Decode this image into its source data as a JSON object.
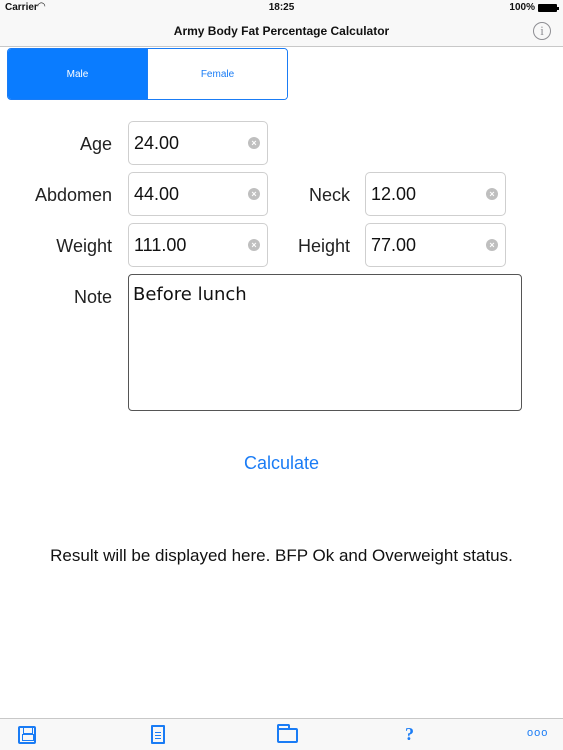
{
  "status_bar": {
    "carrier": "Carrier",
    "time": "18:25",
    "battery": "100%",
    "wifi_icon": "wifi-icon",
    "battery_icon": "battery-icon"
  },
  "nav": {
    "title": "Army Body Fat Percentage Calculator",
    "info_icon": "info-icon",
    "info_glyph": "i"
  },
  "gender": {
    "male": "Male",
    "female": "Female",
    "selected": "Male"
  },
  "form": {
    "age": {
      "label": "Age",
      "value": "24.00"
    },
    "abdomen": {
      "label": "Abdomen",
      "value": "44.00"
    },
    "neck": {
      "label": "Neck",
      "value": "12.00"
    },
    "weight": {
      "label": "Weight",
      "value": "111.00"
    },
    "height": {
      "label": "Height",
      "value": "77.00"
    },
    "note": {
      "label": "Note",
      "value": "Before lunch"
    },
    "clear_glyph": "×"
  },
  "calculate_label": "Calculate",
  "result_text": "Result will be displayed here. BFP Ok and Overweight status.",
  "toolbar": {
    "save_icon": "save-icon",
    "new_icon": "document-icon",
    "open_icon": "folder-icon",
    "help_icon": "help-icon",
    "help_glyph": "?",
    "more_icon": "more-icon",
    "more_glyph": "ooo"
  },
  "colors": {
    "accent": "#1a7cf5",
    "segment_active": "#0a7cff",
    "bar_background": "#f8f8f8"
  }
}
